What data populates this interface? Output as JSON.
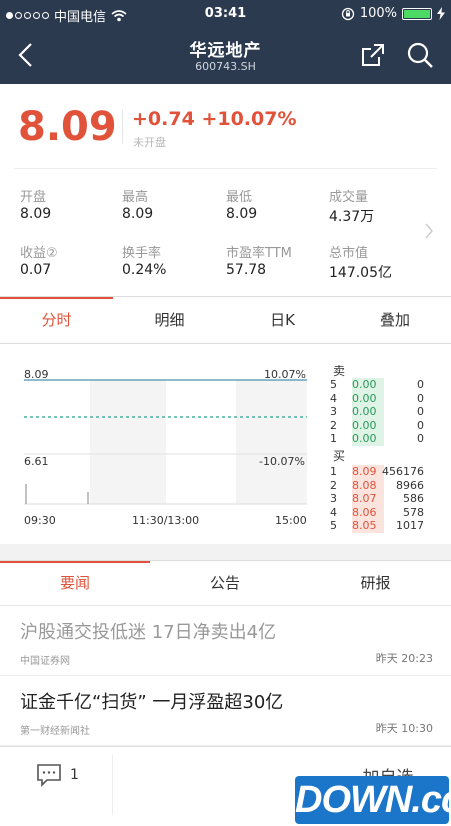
{
  "status_bar": {
    "carrier": "中国电信",
    "time": "03:41",
    "battery": "100%",
    "battery_level": 1.0
  },
  "nav": {
    "title": "华远地产",
    "code": "600743.SH",
    "icons": [
      "back-arrow-icon",
      "share-icon",
      "search-icon"
    ]
  },
  "quote": {
    "price": "8.09",
    "change": "+0.74",
    "change_pct": "+10.07%",
    "state": "未开盘",
    "stats": [
      {
        "label": "开盘",
        "value": "8.09"
      },
      {
        "label": "最高",
        "value": "8.09"
      },
      {
        "label": "最低",
        "value": "8.09"
      },
      {
        "label": "成交量",
        "value": "4.37万"
      },
      {
        "label": "收益②",
        "value": "0.07"
      },
      {
        "label": "换手率",
        "value": "0.24%"
      },
      {
        "label": "市盈率TTM",
        "value": "57.78"
      },
      {
        "label": "总市值",
        "value": "147.05亿"
      }
    ]
  },
  "chart_tabs": [
    "分时",
    "明细",
    "日K",
    "叠加"
  ],
  "chart": {
    "y_top": "8.09",
    "y_bottom": "6.61",
    "pct_top": "10.07%",
    "pct_bottom": "-10.07%",
    "x_labels": [
      "09:30",
      "11:30/13:00",
      "15:00"
    ]
  },
  "chart_data": {
    "type": "line",
    "x": [
      "09:30",
      "11:30/13:00",
      "15:00"
    ],
    "ylim": [
      6.61,
      8.09
    ],
    "price_line": [
      8.09,
      8.09
    ],
    "avg_line": 7.35,
    "volume_spikes": [
      1.0,
      0.6
    ]
  },
  "order_book": {
    "sell_label": "卖",
    "buy_label": "买",
    "sell": [
      {
        "level": "5",
        "price": "0.00",
        "vol": "0"
      },
      {
        "level": "4",
        "price": "0.00",
        "vol": "0"
      },
      {
        "level": "3",
        "price": "0.00",
        "vol": "0"
      },
      {
        "level": "2",
        "price": "0.00",
        "vol": "0"
      },
      {
        "level": "1",
        "price": "0.00",
        "vol": "0"
      }
    ],
    "buy": [
      {
        "level": "1",
        "price": "8.09",
        "vol": "456176"
      },
      {
        "level": "2",
        "price": "8.08",
        "vol": "8966"
      },
      {
        "level": "3",
        "price": "8.07",
        "vol": "586"
      },
      {
        "level": "4",
        "price": "8.06",
        "vol": "578"
      },
      {
        "level": "5",
        "price": "8.05",
        "vol": "1017"
      }
    ]
  },
  "news_tabs": [
    "要闻",
    "公告",
    "研报"
  ],
  "news": [
    {
      "title": "沪股通交投低迷 17日净卖出4亿",
      "source": "中国证券网",
      "time": "昨天 20:23"
    },
    {
      "title": "证金千亿“扫货” 一月浮盈超30亿",
      "source": "第一财经新闻社",
      "time": "昨天 10:30"
    }
  ],
  "bottom": {
    "comment_count": "1",
    "add_label": "加自选"
  },
  "watermark": "DOWN.cc",
  "colors": {
    "nav_bg": "#2c3a4f",
    "up": "#e0533a",
    "down": "#2a9a5a",
    "avg": "#2aa08a"
  }
}
